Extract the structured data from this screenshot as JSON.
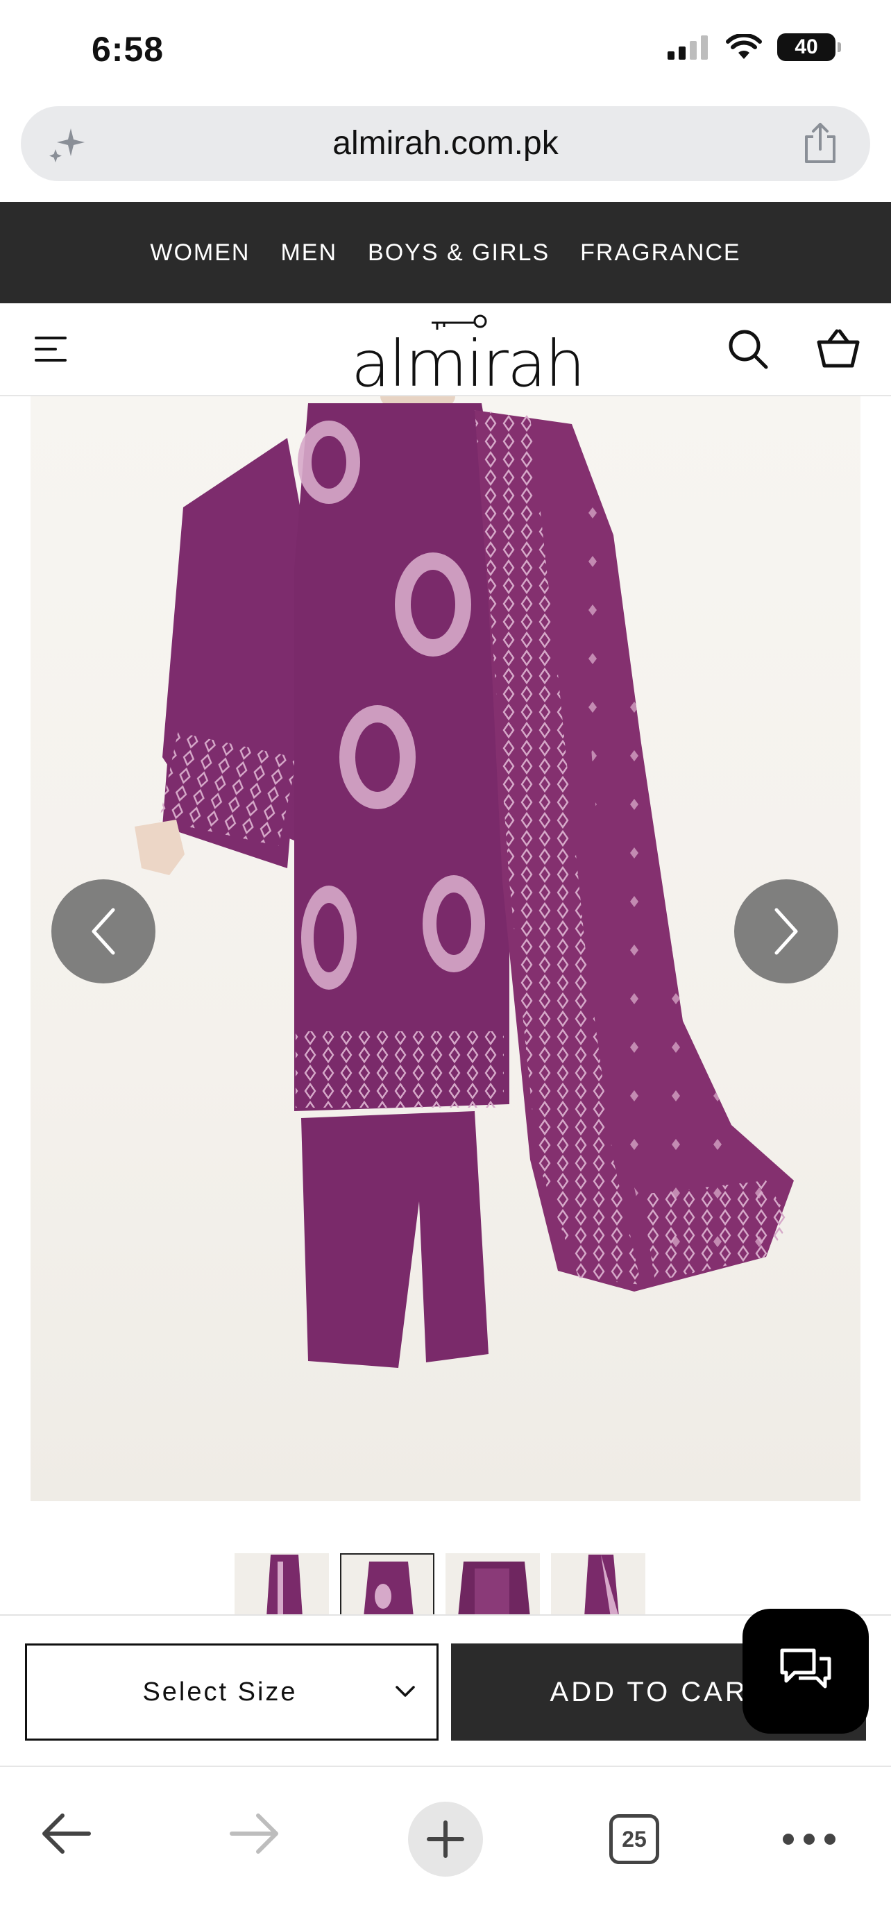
{
  "status_bar": {
    "time": "6:58",
    "battery": "40",
    "icons": [
      "cellular-signal-icon",
      "wifi-icon",
      "battery-icon"
    ]
  },
  "browser": {
    "url": "almirah.com.pk",
    "left_icon": "sparkle-icon",
    "right_icon": "share-icon",
    "toolbar": {
      "tab_count": "25",
      "icons": [
        "back-arrow-icon",
        "forward-arrow-icon",
        "plus-icon",
        "tabs-icon",
        "more-icon"
      ]
    }
  },
  "category_nav": {
    "items": [
      {
        "label": "WOMEN"
      },
      {
        "label": "MEN"
      },
      {
        "label": "BOYS & GIRLS"
      },
      {
        "label": "FRAGRANCE"
      }
    ]
  },
  "header": {
    "logo": "almirah",
    "icons": [
      "hamburger-menu-icon",
      "search-icon",
      "cart-icon"
    ]
  },
  "product": {
    "image_subject": "purple embroidered three-piece suit with dupatta",
    "colors": {
      "fabric": "#7a2a6a",
      "embroidery": "#d6a9c9",
      "background": "#f5f2ed"
    },
    "thumbnail_count": 4,
    "active_thumbnail": 2
  },
  "actions": {
    "size_label": "Select Size",
    "add_to_cart_label": "ADD TO CART",
    "chat_icon": "chat-bubbles-icon"
  }
}
